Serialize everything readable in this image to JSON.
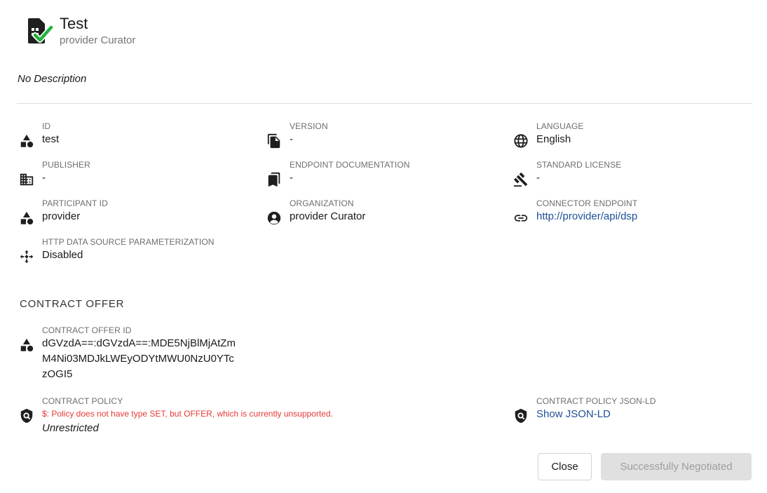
{
  "header": {
    "title": "Test",
    "subtitle": "provider Curator",
    "icon": "sim-card-check-icon",
    "check_color": "#22b33c"
  },
  "description": "No Description",
  "properties": {
    "id": {
      "label": "ID",
      "value": "test",
      "icon": "category-icon"
    },
    "version": {
      "label": "VERSION",
      "value": "-",
      "icon": "file-copy-icon"
    },
    "language": {
      "label": "LANGUAGE",
      "value": "English",
      "icon": "globe-icon"
    },
    "publisher": {
      "label": "PUBLISHER",
      "value": "-",
      "icon": "building-icon"
    },
    "endpoint_documentation": {
      "label": "ENDPOINT DOCUMENTATION",
      "value": "-",
      "icon": "bookmarks-icon"
    },
    "standard_license": {
      "label": "STANDARD LICENSE",
      "value": "-",
      "icon": "gavel-icon"
    },
    "participant_id": {
      "label": "PARTICIPANT ID",
      "value": "provider",
      "icon": "category-icon"
    },
    "organization": {
      "label": "ORGANIZATION",
      "value": "provider Curator",
      "icon": "account-circle-icon"
    },
    "connector_endpoint": {
      "label": "CONNECTOR ENDPOINT",
      "value": "http://provider/api/dsp",
      "icon": "link-icon"
    },
    "http_param": {
      "label": "HTTP DATA SOURCE PARAMETERIZATION",
      "value": "Disabled",
      "icon": "move-arrows-icon"
    }
  },
  "contract_offer": {
    "section_title": "CONTRACT OFFER",
    "offer_id_label": "CONTRACT OFFER ID",
    "offer_id_lines": [
      "dGVzdA==:dGVzdA==:MDE5NjBlMjAtZm",
      "M4Ni03MDJkLWEyODYtMWU0NzU0YTc",
      "zOGI5"
    ],
    "policy_label": "CONTRACT POLICY",
    "policy_error": "$: Policy does not have type SET, but OFFER, which is currently unsupported.",
    "policy_value": "Unrestricted",
    "jsonld_label": "CONTRACT POLICY JSON-LD",
    "jsonld_link": "Show JSON-LD"
  },
  "buttons": {
    "close": "Close",
    "negotiated": "Successfully Negotiated"
  }
}
